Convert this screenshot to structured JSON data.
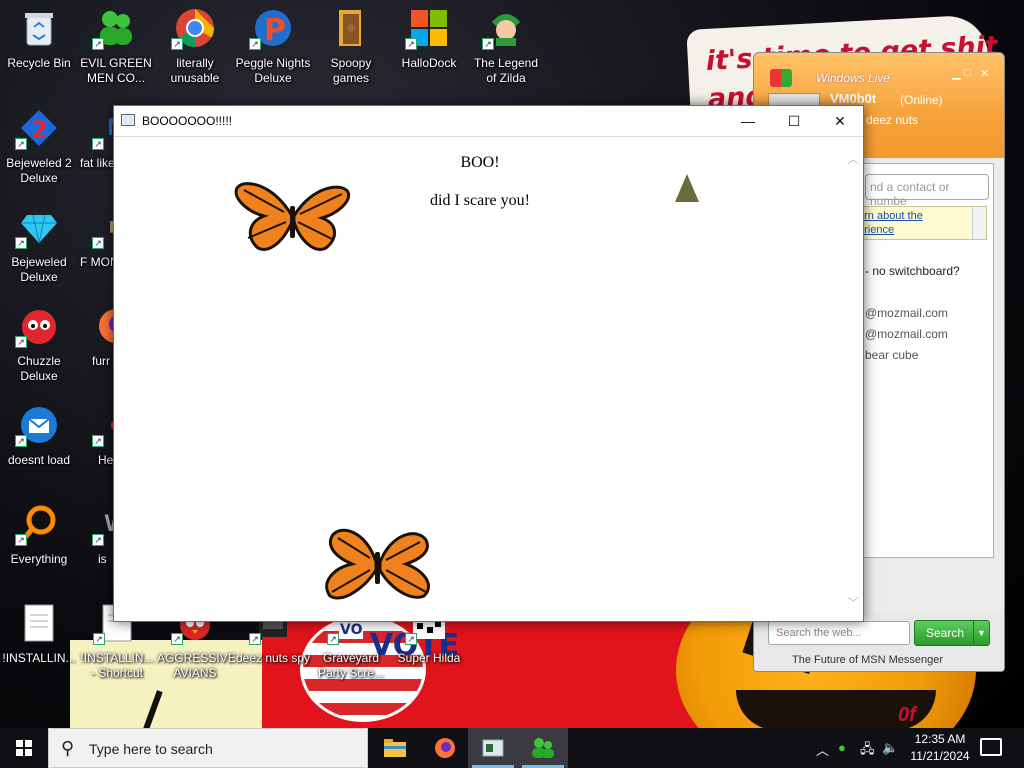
{
  "wallpaper": {
    "sign_text_line1": "it's time to get shit",
    "sign_text_line2": "and",
    "flag_text": "VOTE",
    "leaf_text": "0f"
  },
  "desktop_icons": [
    {
      "label": "Recycle Bin",
      "icon": "recycle-bin-icon"
    },
    {
      "label": "EVIL GREEN MEN CO...",
      "icon": "green-men-icon"
    },
    {
      "label": "literally unusable",
      "icon": "chrome-icon"
    },
    {
      "label": "Peggle Nights Deluxe",
      "icon": "peggle-icon"
    },
    {
      "label": "Spoopy games",
      "icon": "folder-icon"
    },
    {
      "label": "HalloDock",
      "icon": "windows-logo-icon"
    },
    {
      "label": "The Legend of Zilda",
      "icon": "zilda-icon"
    },
    {
      "label": "Bejeweled 2 Deluxe",
      "icon": "bejeweled2-icon"
    },
    {
      "label": "fat like",
      "icon": "app-icon"
    },
    {
      "label": "Bejeweled Deluxe",
      "icon": "diamond-icon"
    },
    {
      "label": "F MON",
      "icon": "app-icon"
    },
    {
      "label": "Chuzzle Deluxe",
      "icon": "chuzzle-icon"
    },
    {
      "label": "furr",
      "icon": "firefox-icon"
    },
    {
      "label": "doesnt load",
      "icon": "thunderbird-icon"
    },
    {
      "label": "He We",
      "icon": "app-icon"
    },
    {
      "label": "Everything",
      "icon": "everything-search-icon"
    },
    {
      "label": "is",
      "icon": "app-icon"
    },
    {
      "label": "!INSTALLIN...",
      "icon": "document-icon"
    },
    {
      "label": "!INSTALLIN... - Shortcut",
      "icon": "document-shortcut-icon"
    },
    {
      "label": "AGGRESSIVE AVIANS",
      "icon": "angry-bird-icon"
    },
    {
      "label": "deez nuts spy",
      "icon": "spy-icon"
    },
    {
      "label": "Graveyard Party Scre...",
      "icon": "graveyard-icon"
    },
    {
      "label": "Super Hilda",
      "icon": "super-hilda-icon"
    }
  ],
  "main_window": {
    "title": "BOOOOOOO!!!!!",
    "content_heading": "BOO!",
    "content_text": "did I scare you!",
    "minimize_glyph": "—",
    "maximize_glyph": "☐",
    "close_glyph": "✕"
  },
  "messenger": {
    "brand": "Windows Live",
    "username": "VM0b0t",
    "status": "(Online)",
    "personal_message": "rate deez nuts",
    "search_contact_placeholder": "nd a contact or numbe",
    "banner_line1": "arn about the",
    "banner_line2": "erience",
    "line_switchboard": "- no switchboard?",
    "contact1": "@mozmail.com",
    "contact2": "@mozmail.com",
    "contact3": "bear cube",
    "web_search_placeholder": "Search the web...",
    "search_button": "Search",
    "footer_text": "The Future of MSN Messenger"
  },
  "taskbar": {
    "search_placeholder": "Type here to search",
    "time": "12:35 AM",
    "date": "11/21/2024",
    "pinned": [
      "file-explorer-icon",
      "firefox-icon",
      "window-app-icon",
      "messenger-icon"
    ]
  },
  "colors": {
    "accent_blue": "#2b7bd4",
    "msn_orange": "#f7a23a",
    "search_green": "#2a9a2a"
  }
}
